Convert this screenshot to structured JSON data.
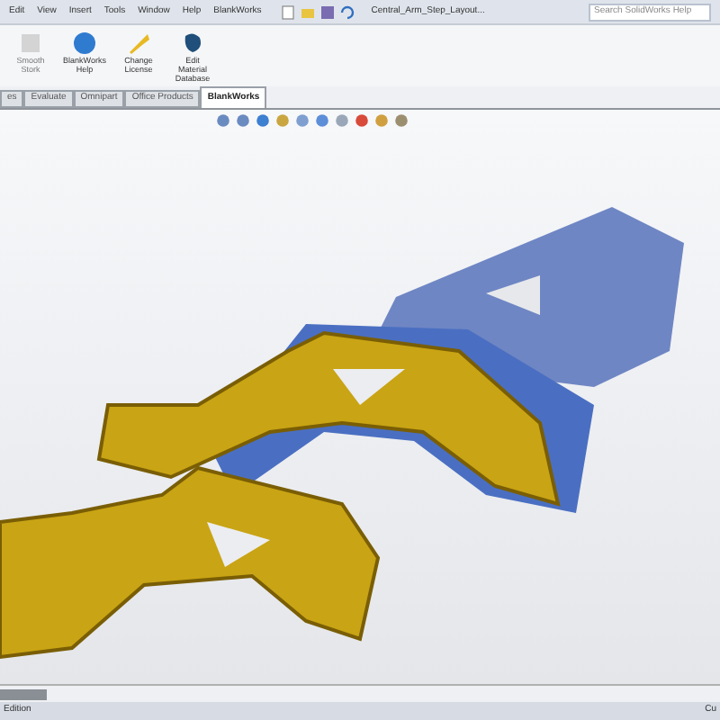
{
  "menu": [
    "Edit",
    "View",
    "Insert",
    "Tools",
    "Window",
    "Help",
    "BlankWorks"
  ],
  "document_title": "Central_Arm_Step_Layout...",
  "search": {
    "placeholder": "Search SolidWorks Help"
  },
  "ribbon": [
    {
      "label": "Smooth Stork",
      "disabled": true
    },
    {
      "label": "BlankWorks Help",
      "disabled": false
    },
    {
      "label": "Change License",
      "disabled": false
    },
    {
      "label": "Edit Material Database",
      "disabled": false
    }
  ],
  "tabs": [
    {
      "label": "es",
      "selected": false
    },
    {
      "label": "Evaluate",
      "selected": false
    },
    {
      "label": "Omnipart",
      "selected": false
    },
    {
      "label": "Office Products",
      "selected": false
    },
    {
      "label": "BlankWorks",
      "selected": true
    }
  ],
  "status_bar": {
    "left": "Edition",
    "right": "Cu"
  }
}
